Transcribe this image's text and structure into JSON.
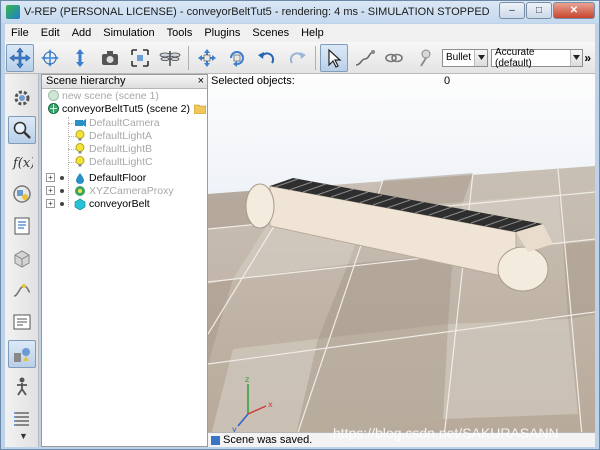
{
  "window": {
    "title": "V-REP (PERSONAL LICENSE) - conveyorBeltTut5 - rendering: 4 ms - SIMULATION STOPPED",
    "minimize_label": "–",
    "maximize_label": "□",
    "close_label": "✕"
  },
  "menubar": {
    "items": [
      "File",
      "Edit",
      "Add",
      "Simulation",
      "Tools",
      "Plugins",
      "Scenes",
      "Help"
    ]
  },
  "toolbar": {
    "engine_select": "Bullet",
    "accuracy_select": "Accurate (default)",
    "overflow_label": "»"
  },
  "hierarchy": {
    "title": "Scene hierarchy",
    "close_label": "×",
    "scene_inactive": "new scene (scene 1)",
    "scene_active": "conveyorBeltTut5 (scene 2)",
    "items": [
      {
        "label": "DefaultCamera",
        "icon": "camera-icon"
      },
      {
        "label": "DefaultLightA",
        "icon": "light-icon"
      },
      {
        "label": "DefaultLightB",
        "icon": "light-icon"
      },
      {
        "label": "DefaultLightC",
        "icon": "light-icon"
      },
      {
        "label": "DefaultFloor",
        "icon": "floor-icon"
      },
      {
        "label": "XYZCameraProxy",
        "icon": "proxy-icon"
      },
      {
        "label": "conveyorBelt",
        "icon": "shape-icon"
      }
    ]
  },
  "scene_view": {
    "selected_label": "Selected objects:",
    "selected_count": "0"
  },
  "status": {
    "message": "Scene was saved."
  },
  "watermark": "https://blog.csdn.net/SAKURASANN",
  "colors": {
    "accent": "#3a74c4",
    "floor_light": "#d2cbc2",
    "floor_dark": "#a89a8c",
    "belt": "#3a3a3a",
    "roller": "#f2e6d8"
  }
}
